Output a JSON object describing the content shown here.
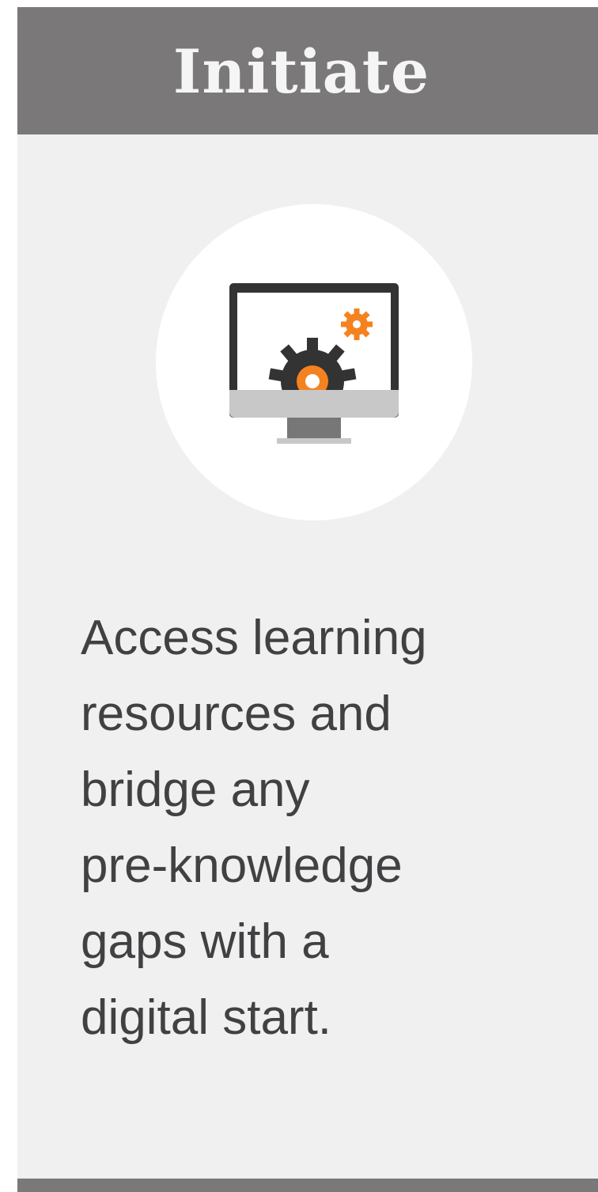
{
  "header": {
    "title": "Initiate"
  },
  "icon": {
    "name": "computer-gear-icon"
  },
  "body": {
    "description": "Access learning\nresources and\nbridge any\npre-knowledge\ngaps with a\ndigital start."
  },
  "colors": {
    "header_bg": "#7a7879",
    "card_bg": "#f0f0f0",
    "title_text": "#f5f5f5",
    "body_text": "#414042",
    "accent_orange": "#f58220",
    "monitor_dark": "#333333",
    "monitor_chin": "#c8c8c8",
    "stand": "#777777"
  }
}
